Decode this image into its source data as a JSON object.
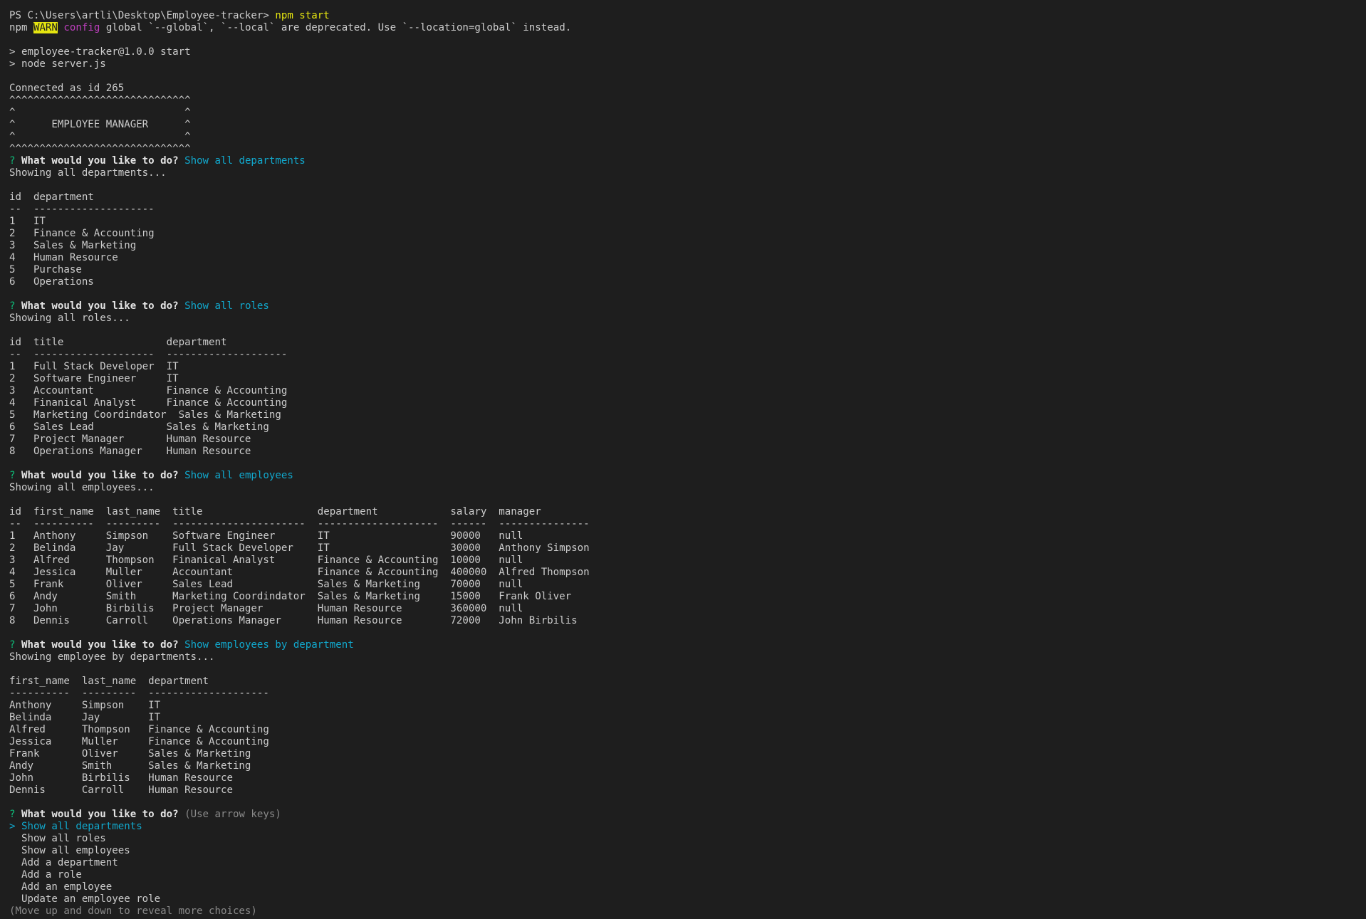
{
  "terminal": {
    "prompt": "PS C:\\Users\\artli\\Desktop\\Employee-tracker> ",
    "command": "npm start",
    "warn": {
      "npm": "npm ",
      "badge": "WARN",
      "sep": " ",
      "config": "config",
      "message": " global `--global`, `--local` are deprecated. Use `--location=global` instead."
    },
    "script_lines": [
      "> employee-tracker@1.0.0 start",
      "> node server.js"
    ],
    "connected": "Connected as id 265",
    "banner": [
      "^^^^^^^^^^^^^^^^^^^^^^^^^^^^^^",
      "^                            ^",
      "^      EMPLOYEE MANAGER      ^",
      "^                            ^",
      "^^^^^^^^^^^^^^^^^^^^^^^^^^^^^^"
    ],
    "question_mark": "? ",
    "question": "What would you like to do?",
    "sections": [
      {
        "answer": " Show all departments",
        "status": "Showing all departments...",
        "table": [
          "id  department",
          "--  --------------------",
          "1   IT",
          "2   Finance & Accounting",
          "3   Sales & Marketing",
          "4   Human Resource",
          "5   Purchase",
          "6   Operations"
        ]
      },
      {
        "answer": " Show all roles",
        "status": "Showing all roles...",
        "table": [
          "id  title                 department",
          "--  --------------------  --------------------",
          "1   Full Stack Developer  IT",
          "2   Software Engineer     IT",
          "3   Accountant            Finance & Accounting",
          "4   Finanical Analyst     Finance & Accounting",
          "5   Marketing Coordindator  Sales & Marketing",
          "6   Sales Lead            Sales & Marketing",
          "7   Project Manager       Human Resource",
          "8   Operations Manager    Human Resource"
        ]
      },
      {
        "answer": " Show all employees",
        "status": "Showing all employees...",
        "table": [
          "id  first_name  last_name  title                   department            salary  manager",
          "--  ----------  ---------  ----------------------  --------------------  ------  ---------------",
          "1   Anthony     Simpson    Software Engineer       IT                    90000   null",
          "2   Belinda     Jay        Full Stack Developer    IT                    30000   Anthony Simpson",
          "3   Alfred      Thompson   Finanical Analyst       Finance & Accounting  10000   null",
          "4   Jessica     Muller     Accountant              Finance & Accounting  400000  Alfred Thompson",
          "5   Frank       Oliver     Sales Lead              Sales & Marketing     70000   null",
          "6   Andy        Smith      Marketing Coordindator  Sales & Marketing     15000   Frank Oliver",
          "7   John        Birbilis   Project Manager         Human Resource        360000  null",
          "8   Dennis      Carroll    Operations Manager      Human Resource        72000   John Birbilis"
        ]
      },
      {
        "answer": " Show employees by department",
        "status": "Showing employee by departments...",
        "table": [
          "first_name  last_name  department",
          "----------  ---------  --------------------",
          "Anthony     Simpson    IT",
          "Belinda     Jay        IT",
          "Alfred      Thompson   Finance & Accounting",
          "Jessica     Muller     Finance & Accounting",
          "Frank       Oliver     Sales & Marketing",
          "Andy        Smith      Sales & Marketing",
          "John        Birbilis   Human Resource",
          "Dennis      Carroll    Human Resource"
        ]
      }
    ],
    "final_hint": " (Use arrow keys)",
    "menu": {
      "selected": "> Show all departments",
      "items": [
        "  Show all roles",
        "  Show all employees",
        "  Add a department",
        "  Add a role",
        "  Add an employee",
        "  Update an employee role"
      ],
      "footer": "(Move up and down to reveal more choices)"
    },
    "colors": {
      "background": "#1e1e1e",
      "text": "#cccccc",
      "yellow": "#e5e510",
      "magenta": "#bc3fbc",
      "cyan": "#11a8cd",
      "green": "#0dbc79",
      "gray": "#8a8a8a"
    }
  }
}
